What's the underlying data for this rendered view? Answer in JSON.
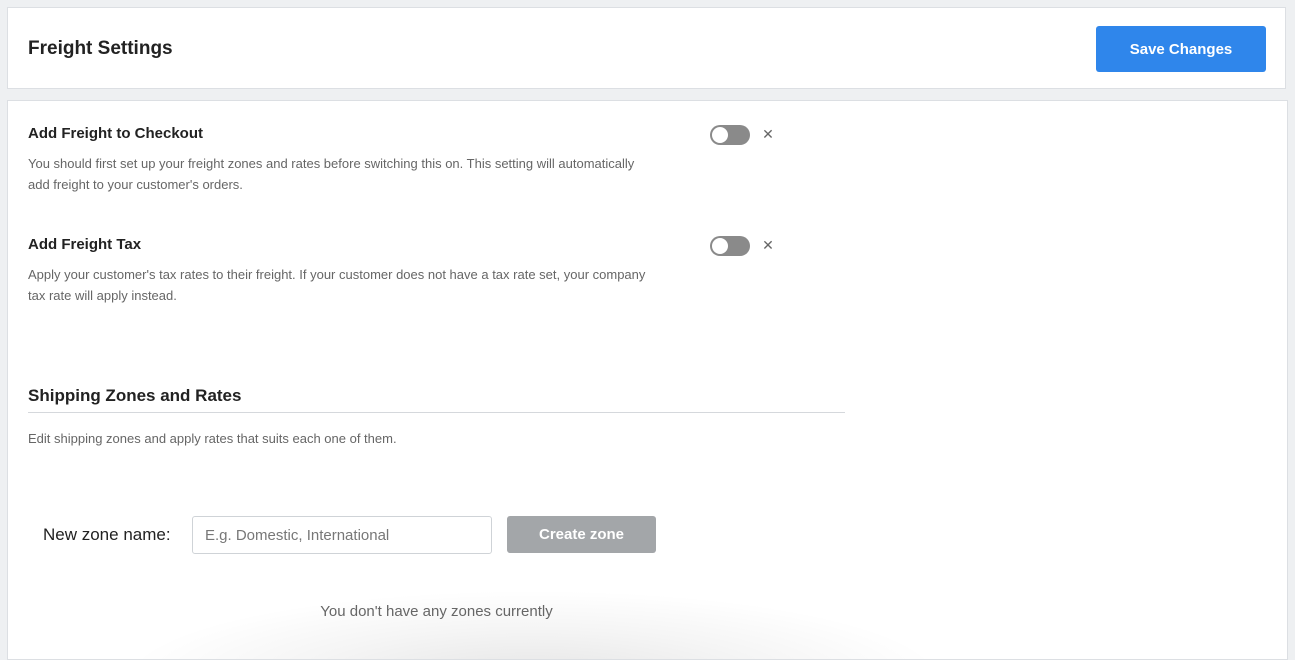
{
  "header": {
    "title": "Freight Settings",
    "save_label": "Save Changes"
  },
  "settings": [
    {
      "title": "Add Freight to Checkout",
      "description": "You should first set up your freight zones and rates before switching this on. This setting will automatically add freight to your customer's orders.",
      "enabled": false
    },
    {
      "title": "Add Freight Tax",
      "description": "Apply your customer's tax rates to their freight. If your customer does not have a tax rate set, your company tax rate will apply instead.",
      "enabled": false
    }
  ],
  "shipping": {
    "title": "Shipping Zones and Rates",
    "description": "Edit shipping zones and apply rates that suits each one of them.",
    "zone_label": "New zone name:",
    "zone_placeholder": "E.g. Domestic, International",
    "zone_value": "",
    "create_label": "Create zone",
    "empty_message": "You don't have any zones currently"
  },
  "icons": {
    "toggle_off": "toggle-off-icon",
    "close": "close-icon"
  },
  "colors": {
    "primary": "#2f86eb",
    "disabled_button": "#a3a6a9",
    "toggle_off": "#8a8a8a"
  }
}
